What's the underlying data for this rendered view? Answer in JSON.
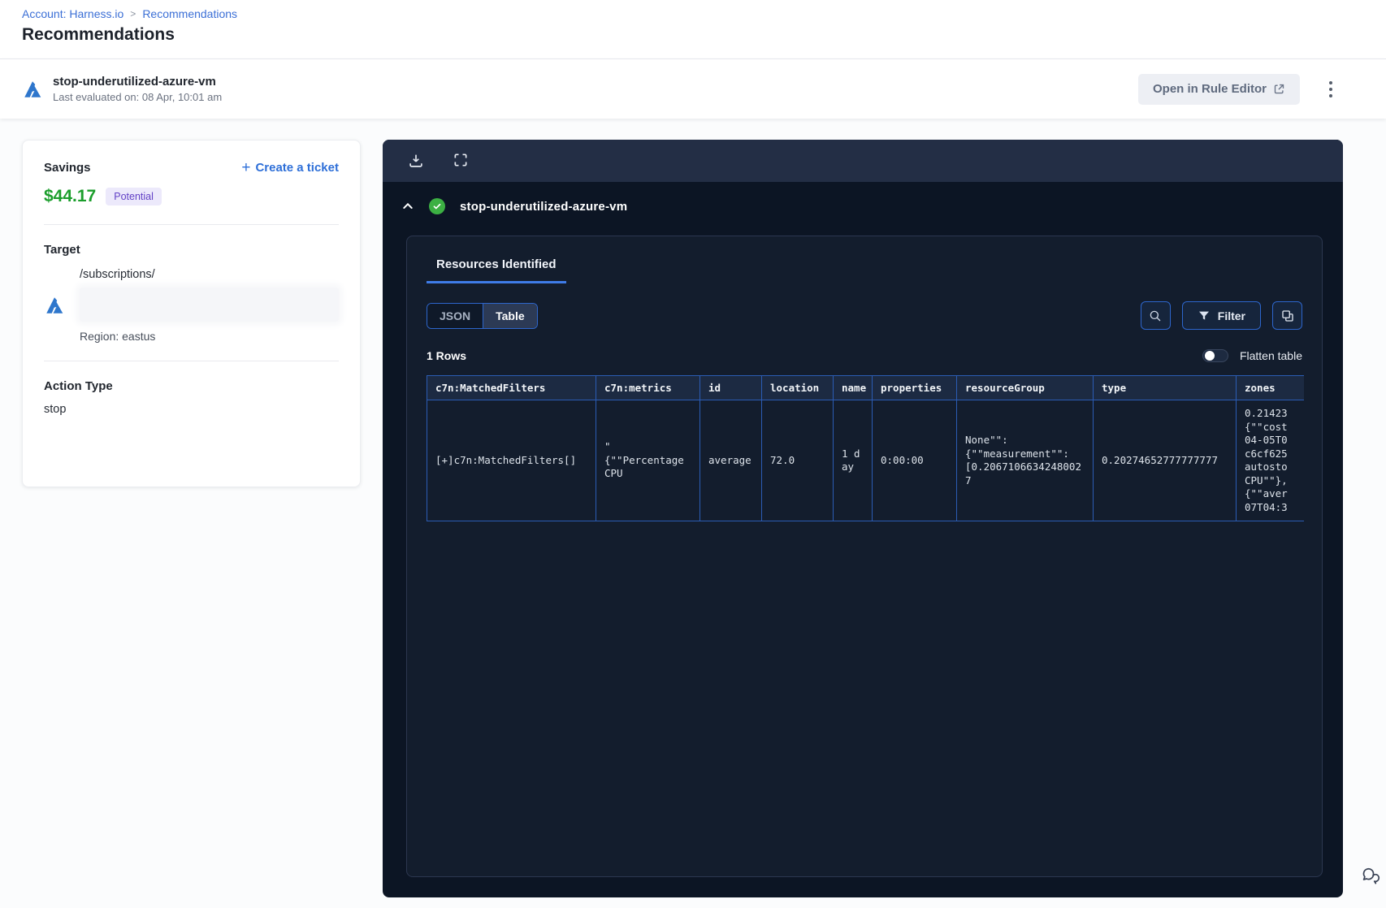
{
  "breadcrumb": {
    "account_label": "Account: Harness.io",
    "separator": ">",
    "current": "Recommendations"
  },
  "page": {
    "title": "Recommendations"
  },
  "header": {
    "rule_name": "stop-underutilized-azure-vm",
    "last_evaluated": "Last evaluated on: 08 Apr, 10:01 am",
    "open_in_rule_editor": "Open in Rule Editor"
  },
  "sidebar": {
    "savings_label": "Savings",
    "savings_amount": "$44.17",
    "savings_badge": "Potential",
    "create_ticket_label": "Create a ticket",
    "target_label": "Target",
    "target_path": "/subscriptions/",
    "target_region": "Region: eastus",
    "action_type_label": "Action Type",
    "action_type_value": "stop"
  },
  "panel": {
    "rule_name": "stop-underutilized-azure-vm",
    "tab_label": "Resources Identified",
    "view_toggle": {
      "json": "JSON",
      "table": "Table",
      "selected": "Table"
    },
    "filter_label": "Filter",
    "rows_label": "1 Rows",
    "flatten_label": "Flatten table",
    "flatten_state": "off",
    "table": {
      "columns": [
        "c7n:MatchedFilters",
        "c7n:metrics",
        "id",
        "location",
        "name",
        "properties",
        "resourceGroup",
        "type",
        "zones"
      ],
      "rows": [
        [
          "[+]c7n:MatchedFilters[]",
          "\"\n{\"\"Percentage CPU",
          "average",
          "72.0",
          "1 day",
          "0:00:00",
          "None\"\":\n{\"\"measurement\"\":\n[0.20671066342480027",
          "0.20274652777777777",
          "0.21423\n{\"\"cost\n04-05T0\nc6cf625\nautosto\nCPU\"\"},\n{\"\"aver\n07T04:3"
        ]
      ]
    }
  },
  "icons": {
    "azure-icon": "azure-logo-triangles",
    "download-icon": "download-into-tray",
    "fullscreen-icon": "corner-brackets",
    "collapse-icon": "chevron-up",
    "status-success-icon": "green-check-circle",
    "search-icon": "magnifier",
    "filter-icon": "funnel",
    "copy-icon": "overlapping-squares",
    "more-icon": "vertical-kebab-dots",
    "external-link-icon": "arrow-out-of-square",
    "plus-icon": "plus",
    "chat-icon": "speech-bubbles",
    "flatten-toggle-icon": "switch-off"
  },
  "colors": {
    "link_blue": "#3b6fd6",
    "savings_green": "#1b9e2c",
    "badge_bg": "#ece9fb",
    "badge_text": "#6241c6",
    "tab_accent": "#3f7ce8",
    "panel_bg": "#0c1524",
    "panel_toolbar_bg": "#232e45",
    "inner_card_bg": "#131d2d",
    "table_border": "#2b5cb4",
    "button_border": "#2d66cc",
    "success_green": "#3cb043"
  }
}
